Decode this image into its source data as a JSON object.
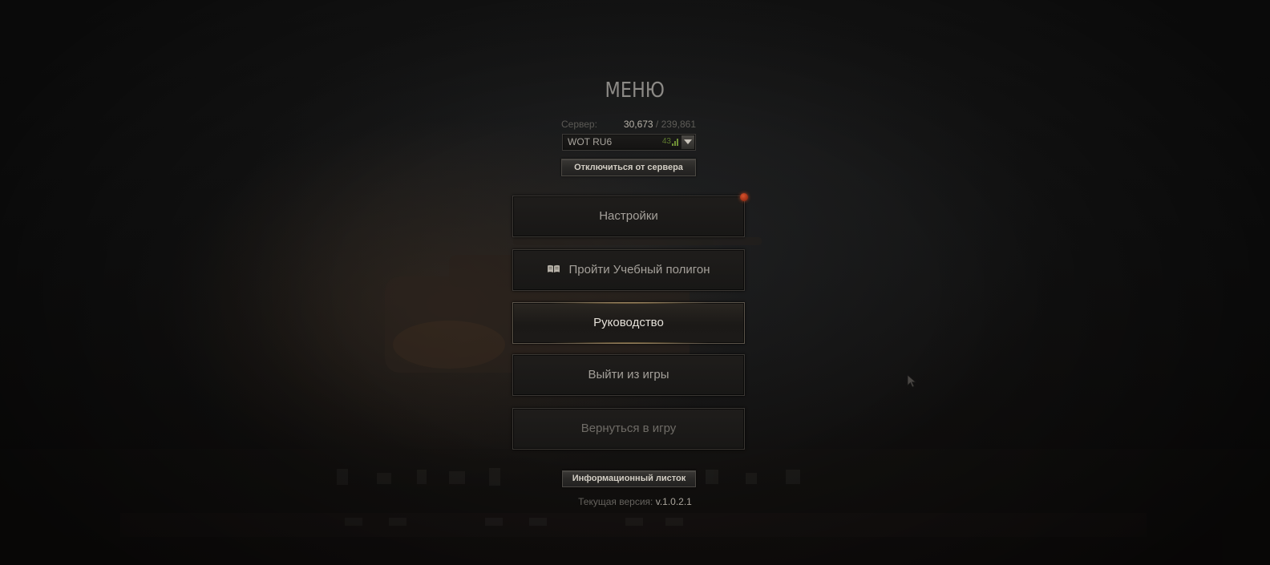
{
  "menu": {
    "title": "МЕНЮ"
  },
  "server": {
    "label": "Сервер:",
    "online": "30,673",
    "separator": " / ",
    "total": "239,861",
    "selected": "WOT RU6",
    "ping": "43",
    "ping_color": "#6f8f35"
  },
  "buttons": {
    "disconnect": "Отключиться от сервера",
    "settings": "Настройки",
    "training": "Пройти Учебный полигон",
    "guide": "Руководство",
    "exit": "Выйти из игры",
    "return": "Вернуться в игру",
    "info_sheet": "Информационный листок"
  },
  "icons": {
    "training": "book-icon",
    "dropdown": "chevron-down-icon",
    "ping": "signal-bars-icon",
    "settings_badge": "notification-dot"
  },
  "version": {
    "label": "Текущая версия: ",
    "value": "v.1.0.2.1"
  },
  "colors": {
    "background": "#0f0d0c",
    "button_text": "#a4a09a",
    "highlight_text": "#e4e0d8",
    "notification": "#d8512b"
  }
}
